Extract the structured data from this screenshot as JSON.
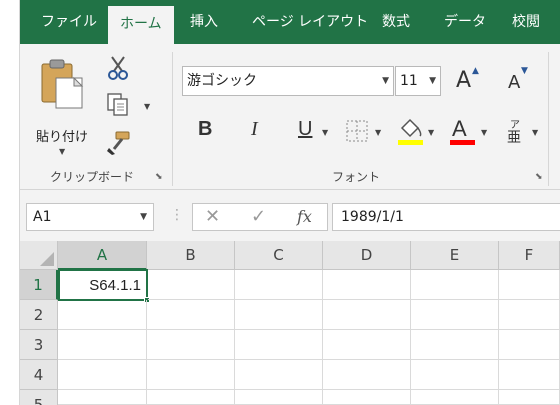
{
  "tabs": [
    {
      "label": "ファイル",
      "active": false
    },
    {
      "label": "ホーム",
      "active": true
    },
    {
      "label": "挿入",
      "active": false
    },
    {
      "label": "ページ レイアウト",
      "active": false
    },
    {
      "label": "数式",
      "active": false
    },
    {
      "label": "データ",
      "active": false
    },
    {
      "label": "校閲",
      "active": false
    }
  ],
  "clipboard": {
    "paste_label": "貼り付け",
    "group_label": "クリップボード",
    "icons": [
      "paste-icon",
      "cut-icon",
      "copy-icon",
      "format-painter-icon"
    ]
  },
  "font": {
    "group_label": "フォント",
    "font_name": "游ゴシック",
    "font_size": "11",
    "bold": "B",
    "italic": "I",
    "underline": "U",
    "font_color_letter": "A",
    "phonetic_top": "ア",
    "phonetic_bottom": "亜",
    "grow_letter": "A",
    "shrink_letter": "A",
    "fill_color": "#ffff00",
    "font_color": "#ff0000"
  },
  "formula_bar": {
    "name_box": "A1",
    "cancel": "✕",
    "enter": "✓",
    "fx": "fx",
    "value": "1989/1/1"
  },
  "sheet": {
    "columns": [
      "A",
      "B",
      "C",
      "D",
      "E",
      "F"
    ],
    "rows": [
      "1",
      "2",
      "3",
      "4",
      "5"
    ],
    "active_cell": "A1",
    "cells": {
      "A1": "S64.1.1"
    }
  },
  "colors": {
    "accent": "#217346",
    "ribbon_bg": "#f3f3f3"
  }
}
